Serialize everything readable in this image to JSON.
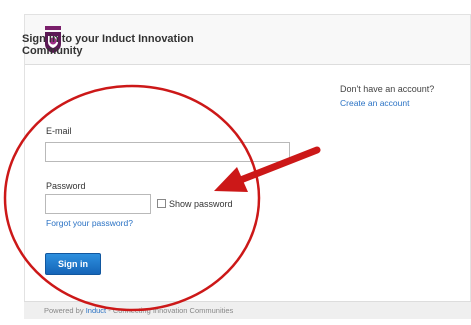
{
  "header": {
    "logo_icon": "brand-shield-logo"
  },
  "signin": {
    "title": "Sign in to your Induct Innovation Community",
    "email_label": "E-mail",
    "email_value": "",
    "password_label": "Password",
    "password_value": "",
    "show_password_label": "Show password",
    "forgot_link": "Forgot your password?",
    "signin_button": "Sign in"
  },
  "sidebar": {
    "no_account_text": "Don't have an account?",
    "create_link": "Create an account"
  },
  "footer": {
    "powered_by": "Powered by",
    "brand": "Induct",
    "tagline": "- Connecting Innovation Communities"
  },
  "annotation": {
    "color": "#cc1818"
  }
}
